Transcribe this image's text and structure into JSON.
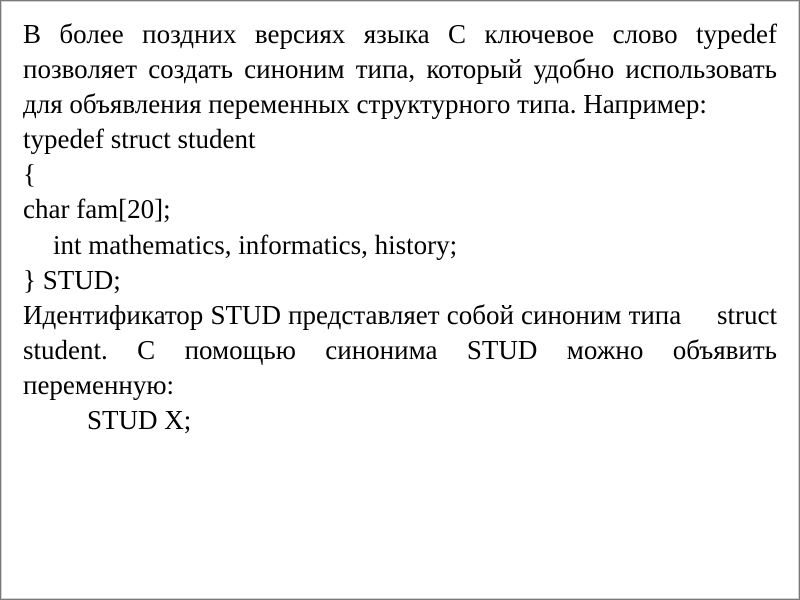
{
  "para1": "В более поздних версиях языка С ключевое слово typedef позволяет создать синоним типа, который удобно использовать для объявления переменных структурного типа. Например:",
  "code": {
    "l1": "typedef struct student",
    "l2": "{",
    "l3": "char  fam[20];",
    "l4": "int mathematics, informatics, history;",
    "l5": "} STUD;"
  },
  "para2a": "Идентификатор STUD представляет собой синоним типа",
  "para2b": " struct student. С помощью синонима STUD можно объявить переменную:",
  "code2": "STUD X;"
}
